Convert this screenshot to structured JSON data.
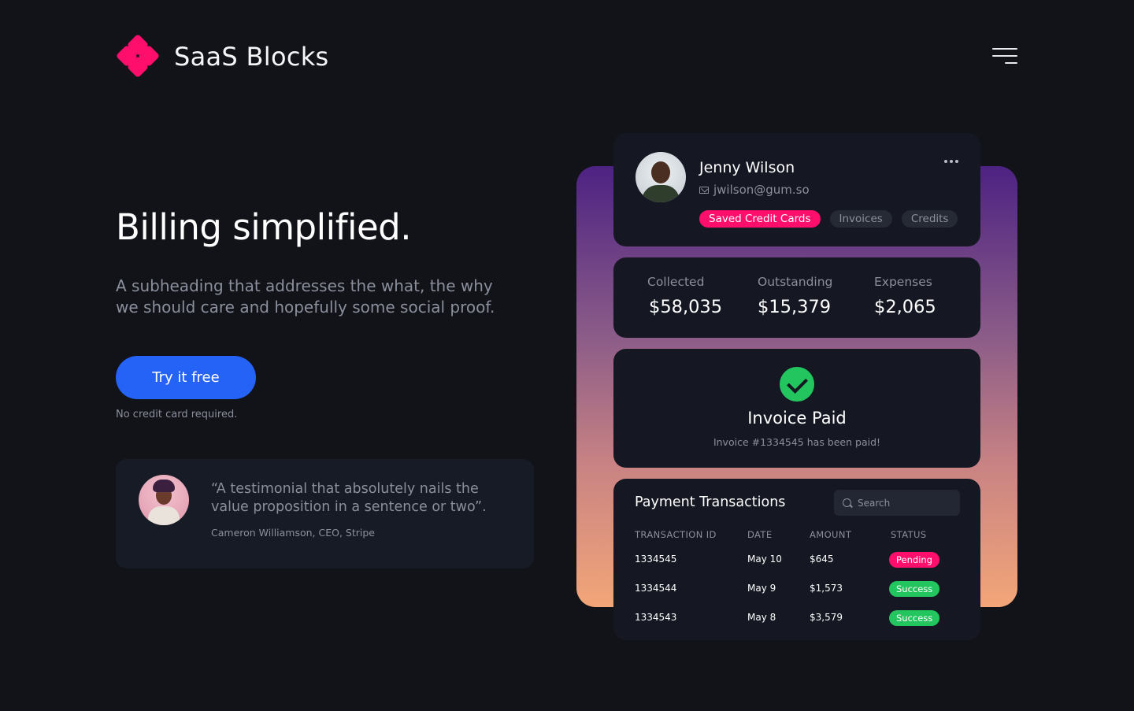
{
  "brand": {
    "name": "SaaS Blocks",
    "accent": "#ff0f6b"
  },
  "header": {
    "menu_icon": "hamburger-menu-icon"
  },
  "hero": {
    "title": "Billing simplified.",
    "subtitle": "A subheading that addresses the what, the why we should care and hopefully some social proof.",
    "cta_label": "Try it free",
    "cta_note": "No credit card required.",
    "cta_color": "#2563f6"
  },
  "testimonial": {
    "quote": "“A testimonial that absolutely nails the value proposition in a sentence or two”.",
    "author": "Cameron Williamson, CEO, Stripe"
  },
  "profile": {
    "name": "Jenny Wilson",
    "email": "jwilson@gum.so",
    "tabs": [
      {
        "label": "Saved Credit Cards",
        "active": true
      },
      {
        "label": "Invoices",
        "active": false
      },
      {
        "label": "Credits",
        "active": false
      }
    ]
  },
  "stats": [
    {
      "label": "Collected",
      "value": "$58,035"
    },
    {
      "label": "Outstanding",
      "value": "$15,379"
    },
    {
      "label": "Expenses",
      "value": "$2,065"
    }
  ],
  "invoice": {
    "title": "Invoice Paid",
    "subtitle": "Invoice #1334545 has been paid!",
    "status_color": "#22c55e"
  },
  "transactions": {
    "title": "Payment Transactions",
    "search_placeholder": "Search",
    "columns": [
      "TRANSACTION ID",
      "DATE",
      "AMOUNT",
      "STATUS"
    ],
    "rows": [
      {
        "id": "1334545",
        "date": "May 10",
        "amount": "$645",
        "status": "Pending"
      },
      {
        "id": "1334544",
        "date": "May 9",
        "amount": "$1,573",
        "status": "Success"
      },
      {
        "id": "1334543",
        "date": "May 8",
        "amount": "$3,579",
        "status": "Success"
      }
    ]
  }
}
